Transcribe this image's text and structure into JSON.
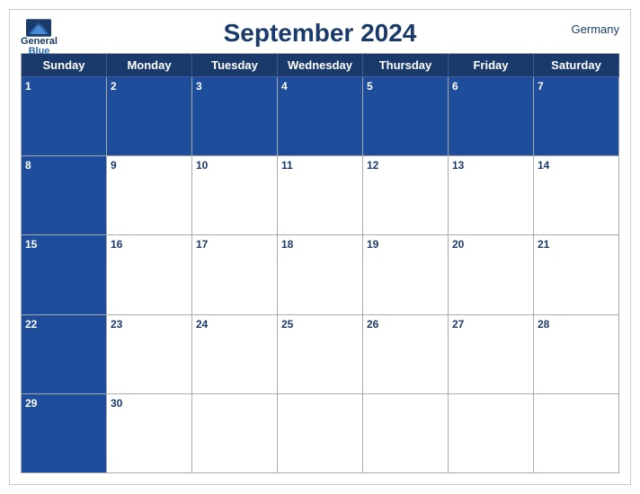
{
  "calendar": {
    "title": "September 2024",
    "country": "Germany",
    "logo": {
      "general": "General",
      "blue": "Blue"
    },
    "dayHeaders": [
      "Sunday",
      "Monday",
      "Tuesday",
      "Wednesday",
      "Thursday",
      "Friday",
      "Saturday"
    ],
    "weeks": [
      [
        {
          "date": 1,
          "style": "blue"
        },
        {
          "date": 2,
          "style": "blue"
        },
        {
          "date": 3,
          "style": "blue"
        },
        {
          "date": 4,
          "style": "blue"
        },
        {
          "date": 5,
          "style": "blue"
        },
        {
          "date": 6,
          "style": "blue"
        },
        {
          "date": 7,
          "style": "blue"
        }
      ],
      [
        {
          "date": 8,
          "style": "blue"
        },
        {
          "date": 9,
          "style": "white"
        },
        {
          "date": 10,
          "style": "white"
        },
        {
          "date": 11,
          "style": "white"
        },
        {
          "date": 12,
          "style": "white"
        },
        {
          "date": 13,
          "style": "white"
        },
        {
          "date": 14,
          "style": "white"
        }
      ],
      [
        {
          "date": 15,
          "style": "blue"
        },
        {
          "date": 16,
          "style": "white"
        },
        {
          "date": 17,
          "style": "white"
        },
        {
          "date": 18,
          "style": "white"
        },
        {
          "date": 19,
          "style": "white"
        },
        {
          "date": 20,
          "style": "white"
        },
        {
          "date": 21,
          "style": "white"
        }
      ],
      [
        {
          "date": 22,
          "style": "blue"
        },
        {
          "date": 23,
          "style": "white"
        },
        {
          "date": 24,
          "style": "white"
        },
        {
          "date": 25,
          "style": "white"
        },
        {
          "date": 26,
          "style": "white"
        },
        {
          "date": 27,
          "style": "white"
        },
        {
          "date": 28,
          "style": "white"
        }
      ],
      [
        {
          "date": 29,
          "style": "blue"
        },
        {
          "date": 30,
          "style": "white"
        },
        {
          "date": null,
          "style": "empty"
        },
        {
          "date": null,
          "style": "empty"
        },
        {
          "date": null,
          "style": "empty"
        },
        {
          "date": null,
          "style": "empty"
        },
        {
          "date": null,
          "style": "empty"
        }
      ]
    ]
  }
}
